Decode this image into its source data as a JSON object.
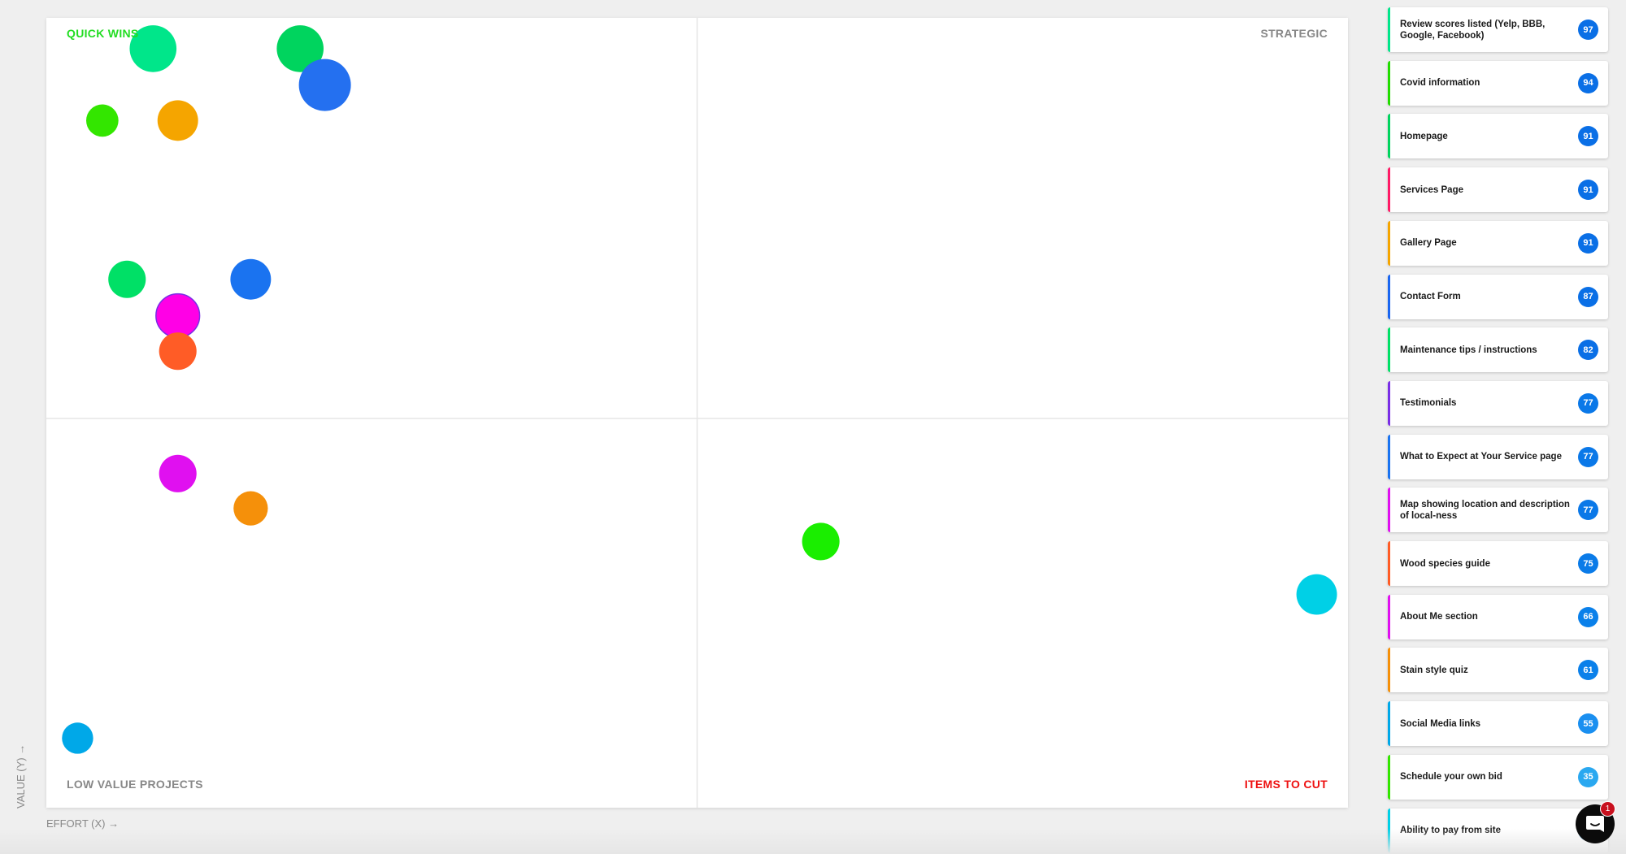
{
  "chart_data": {
    "type": "scatter",
    "quadrants": {
      "top_left": {
        "label": "QUICK WINS",
        "color": "#22dd22"
      },
      "top_right": {
        "label": "STRATEGIC",
        "color": "#888888"
      },
      "bottom_left": {
        "label": "LOW VALUE PROJECTS",
        "color": "#888888"
      },
      "bottom_right": {
        "label": "ITEMS TO CUT",
        "color": "#ee1111"
      }
    },
    "xlabel": "EFFORT (X) →",
    "ylabel": "VALUE (Y) →",
    "xlim": [
      0,
      100
    ],
    "ylim": [
      0,
      100
    ],
    "grid": "quadrant dividers",
    "points": [
      {
        "x": 8.2,
        "y": 96.1,
        "size": 0.9,
        "color": "#00e68a"
      },
      {
        "x": 19.5,
        "y": 96.1,
        "size": 0.9,
        "color": "#00d45e"
      },
      {
        "x": 21.4,
        "y": 91.5,
        "size": 1.0,
        "color": "#2470f0"
      },
      {
        "x": 4.3,
        "y": 87.0,
        "size": 0.62,
        "color": "#33e600"
      },
      {
        "x": 10.1,
        "y": 87.0,
        "size": 0.78,
        "color": "#f5a500"
      },
      {
        "x": 6.2,
        "y": 66.9,
        "size": 0.72,
        "color": "#00e066"
      },
      {
        "x": 15.7,
        "y": 66.9,
        "size": 0.78,
        "color": "#1a73f0"
      },
      {
        "x": 10.1,
        "y": 62.3,
        "size": 0.84,
        "color": "#ff00e6",
        "stroke": "#7a2ee6"
      },
      {
        "x": 10.1,
        "y": 57.8,
        "size": 0.72,
        "color": "#ff5c26"
      },
      {
        "x": 10.1,
        "y": 42.3,
        "size": 0.72,
        "color": "#e010f0"
      },
      {
        "x": 15.7,
        "y": 37.9,
        "size": 0.66,
        "color": "#f5900a"
      },
      {
        "x": 59.5,
        "y": 33.7,
        "size": 0.72,
        "color": "#1aee00"
      },
      {
        "x": 97.6,
        "y": 27.0,
        "size": 0.78,
        "color": "#00d0e6"
      },
      {
        "x": 2.4,
        "y": 8.8,
        "size": 0.6,
        "color": "#00a8e8"
      }
    ]
  },
  "sidebar": {
    "items": [
      {
        "label": "Review scores listed (Yelp, BBB, Google, Facebook)",
        "score": "97",
        "color": "#00e68a",
        "badge": "#0a6fe6"
      },
      {
        "label": "Covid information",
        "score": "94",
        "color": "#22dd00",
        "badge": "#0a6fe6"
      },
      {
        "label": "Homepage",
        "score": "91",
        "color": "#00d45e",
        "badge": "#0a6fe6"
      },
      {
        "label": "Services Page",
        "score": "91",
        "color": "#ff1a66",
        "badge": "#0a6fe6"
      },
      {
        "label": "Gallery Page",
        "score": "91",
        "color": "#f5a500",
        "badge": "#0a6fe6"
      },
      {
        "label": "Contact Form",
        "score": "87",
        "color": "#1a66f0",
        "badge": "#0a6fe6"
      },
      {
        "label": "Maintenance tips / instructions",
        "score": "82",
        "color": "#00e066",
        "badge": "#0a6fe6"
      },
      {
        "label": "Testimonials",
        "score": "77",
        "color": "#7a2ee6",
        "badge": "#0a78e8"
      },
      {
        "label": "What to Expect at Your Service page",
        "score": "77",
        "color": "#1a73f0",
        "badge": "#0a78e8"
      },
      {
        "label": "Map showing location and description of local-ness",
        "score": "77",
        "color": "#e010f0",
        "badge": "#0a78e8"
      },
      {
        "label": "Wood species guide",
        "score": "75",
        "color": "#ff5c26",
        "badge": "#0a7be8"
      },
      {
        "label": "About Me section",
        "score": "66",
        "color": "#e010f0",
        "badge": "#0a80ea"
      },
      {
        "label": "Stain style quiz",
        "score": "61",
        "color": "#f5900a",
        "badge": "#0a80ea"
      },
      {
        "label": "Social Media links",
        "score": "55",
        "color": "#00a8e8",
        "badge": "#1a8ff0"
      },
      {
        "label": "Schedule your own bid",
        "score": "35",
        "color": "#33e600",
        "badge": "#2aa8f0"
      },
      {
        "label": "Ability to pay from site",
        "score": "",
        "color": "#00d0e6",
        "badge": "#5ab0e0"
      }
    ]
  },
  "chat_widget": {
    "unread_count": "1",
    "icon": "chat-bubble-icon"
  }
}
